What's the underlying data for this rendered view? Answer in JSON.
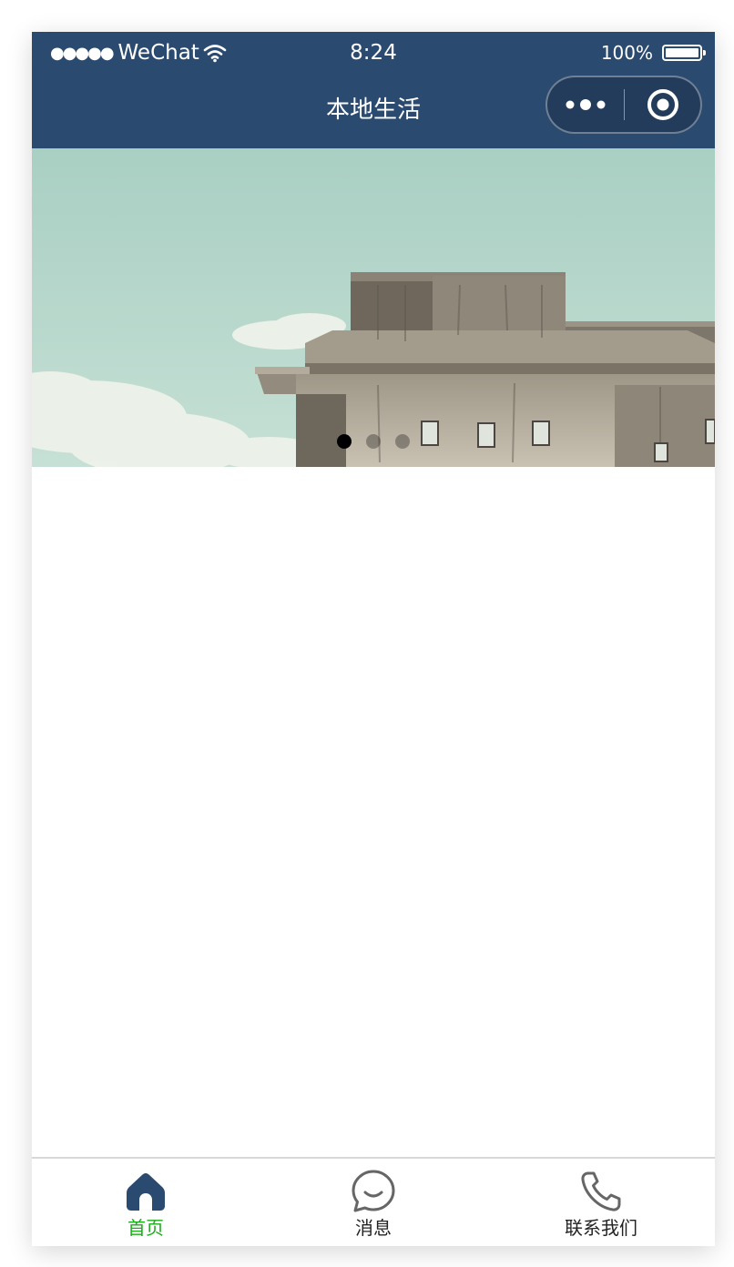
{
  "status_bar": {
    "signal": "●●●●●",
    "carrier": "WeChat",
    "time": "8:24",
    "battery": "100%",
    "battery_level": 1.0
  },
  "nav": {
    "title": "本地生活"
  },
  "banner": {
    "indicator_count": 3,
    "active_index": 0
  },
  "tabbar": {
    "tabs": [
      {
        "label": "首页",
        "icon": "home-icon",
        "active": true
      },
      {
        "label": "消息",
        "icon": "message-icon",
        "active": false
      },
      {
        "label": "联系我们",
        "icon": "phone-icon",
        "active": false
      }
    ]
  },
  "colors": {
    "nav_background": "#2b4a6f",
    "tab_active": "#1aad19",
    "tab_inactive": "#222222",
    "home_icon": "#2b4a6f",
    "icon_gray": "#666666"
  }
}
